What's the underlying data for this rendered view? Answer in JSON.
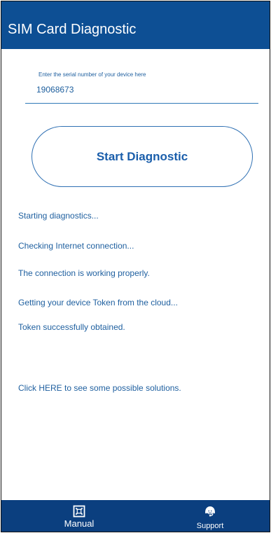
{
  "app": {
    "title": "SIM Card Diagnostic"
  },
  "serial": {
    "label": "Enter the serial number of your device here",
    "value": "19068673"
  },
  "actions": {
    "start_label": "Start Diagnostic"
  },
  "log": {
    "lines": [
      "Starting diagnostics...",
      "Checking Internet connection...",
      "The connection is working properly.",
      "Getting your device Token from the cloud...",
      "Token successfully obtained."
    ]
  },
  "help": {
    "link_text": "Click HERE to see some possible solutions."
  },
  "nav": {
    "items": [
      {
        "label": "Manual",
        "icon": "manual-icon"
      },
      {
        "label": "Support",
        "icon": "support-icon"
      }
    ]
  },
  "colors": {
    "header": "#0d4f94",
    "bottom_nav": "#0b3f7f",
    "text": "#1e5f9f",
    "accent": "#1a5eab",
    "background": "#ffffff"
  }
}
